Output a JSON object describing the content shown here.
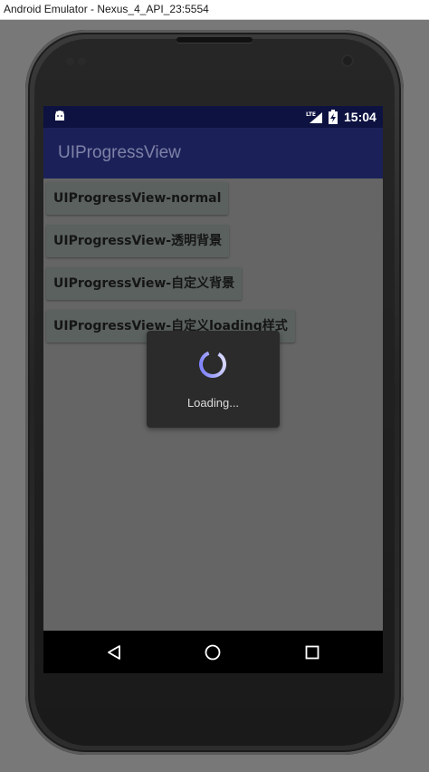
{
  "window": {
    "title": "Android Emulator - Nexus_4_API_23:5554"
  },
  "status_bar": {
    "notification_icon": "android-icon",
    "network_label": "LTE",
    "time": "15:04"
  },
  "app_bar": {
    "title": "UIProgressView"
  },
  "buttons": [
    {
      "label": "UIProgressView-normal"
    },
    {
      "label": "UIProgressView-透明背景"
    },
    {
      "label": "UIProgressView-自定义背景"
    },
    {
      "label": "UIProgressView-自定义loading样式"
    }
  ],
  "dialog": {
    "message": "Loading..."
  },
  "nav_bar": {
    "back": "back-icon",
    "home": "home-icon",
    "recents": "recents-icon"
  },
  "colors": {
    "status_bar": "#0d1240",
    "app_bar": "#1b2158",
    "spinner_accent": "#8a8fff"
  }
}
